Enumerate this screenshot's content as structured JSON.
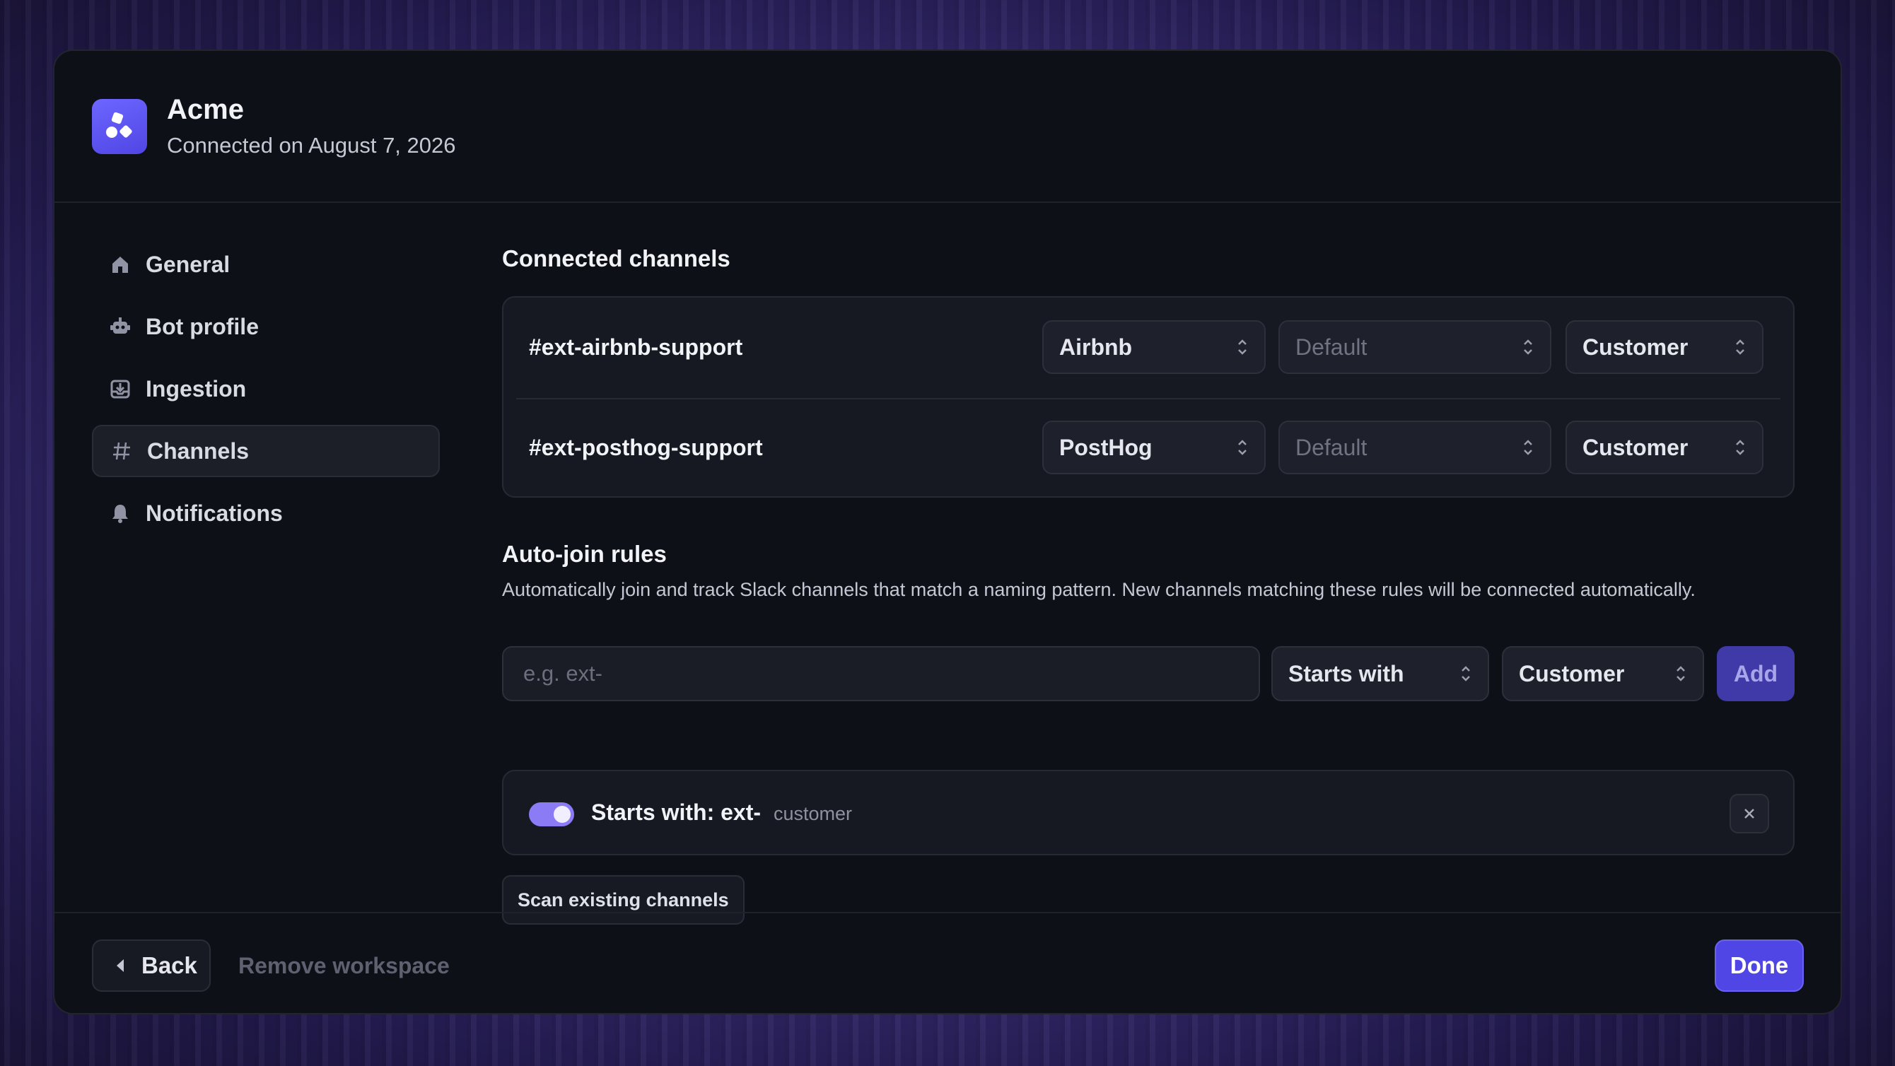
{
  "workspace": {
    "name": "Acme",
    "connected_text": "Connected on August 7, 2026"
  },
  "sidebar": {
    "items": [
      {
        "label": "General",
        "icon": "home-icon"
      },
      {
        "label": "Bot profile",
        "icon": "robot-icon"
      },
      {
        "label": "Ingestion",
        "icon": "inbox-icon"
      },
      {
        "label": "Channels",
        "icon": "hash-icon",
        "active": true
      },
      {
        "label": "Notifications",
        "icon": "bell-icon"
      }
    ]
  },
  "connected_channels": {
    "title": "Connected channels",
    "rows": [
      {
        "channel": "#ext-airbnb-support",
        "company": "Airbnb",
        "template": "Default",
        "role": "Customer"
      },
      {
        "channel": "#ext-posthog-support",
        "company": "PostHog",
        "template": "Default",
        "role": "Customer"
      }
    ]
  },
  "auto_join": {
    "title": "Auto-join rules",
    "description": "Automatically join and track Slack channels that match a naming pattern. New channels matching these rules will be connected automatically.",
    "pattern_placeholder": "e.g. ext-",
    "match_type": "Starts with",
    "role": "Customer",
    "add_label": "Add",
    "rules": [
      {
        "label": "Starts with: ext-",
        "tag": "customer",
        "enabled": true
      }
    ],
    "scan_label": "Scan existing channels"
  },
  "footer": {
    "back_label": "Back",
    "remove_label": "Remove workspace",
    "done_label": "Done"
  },
  "colors": {
    "accent": "#4f46e5",
    "annotation_arrow": "#e8264f"
  }
}
